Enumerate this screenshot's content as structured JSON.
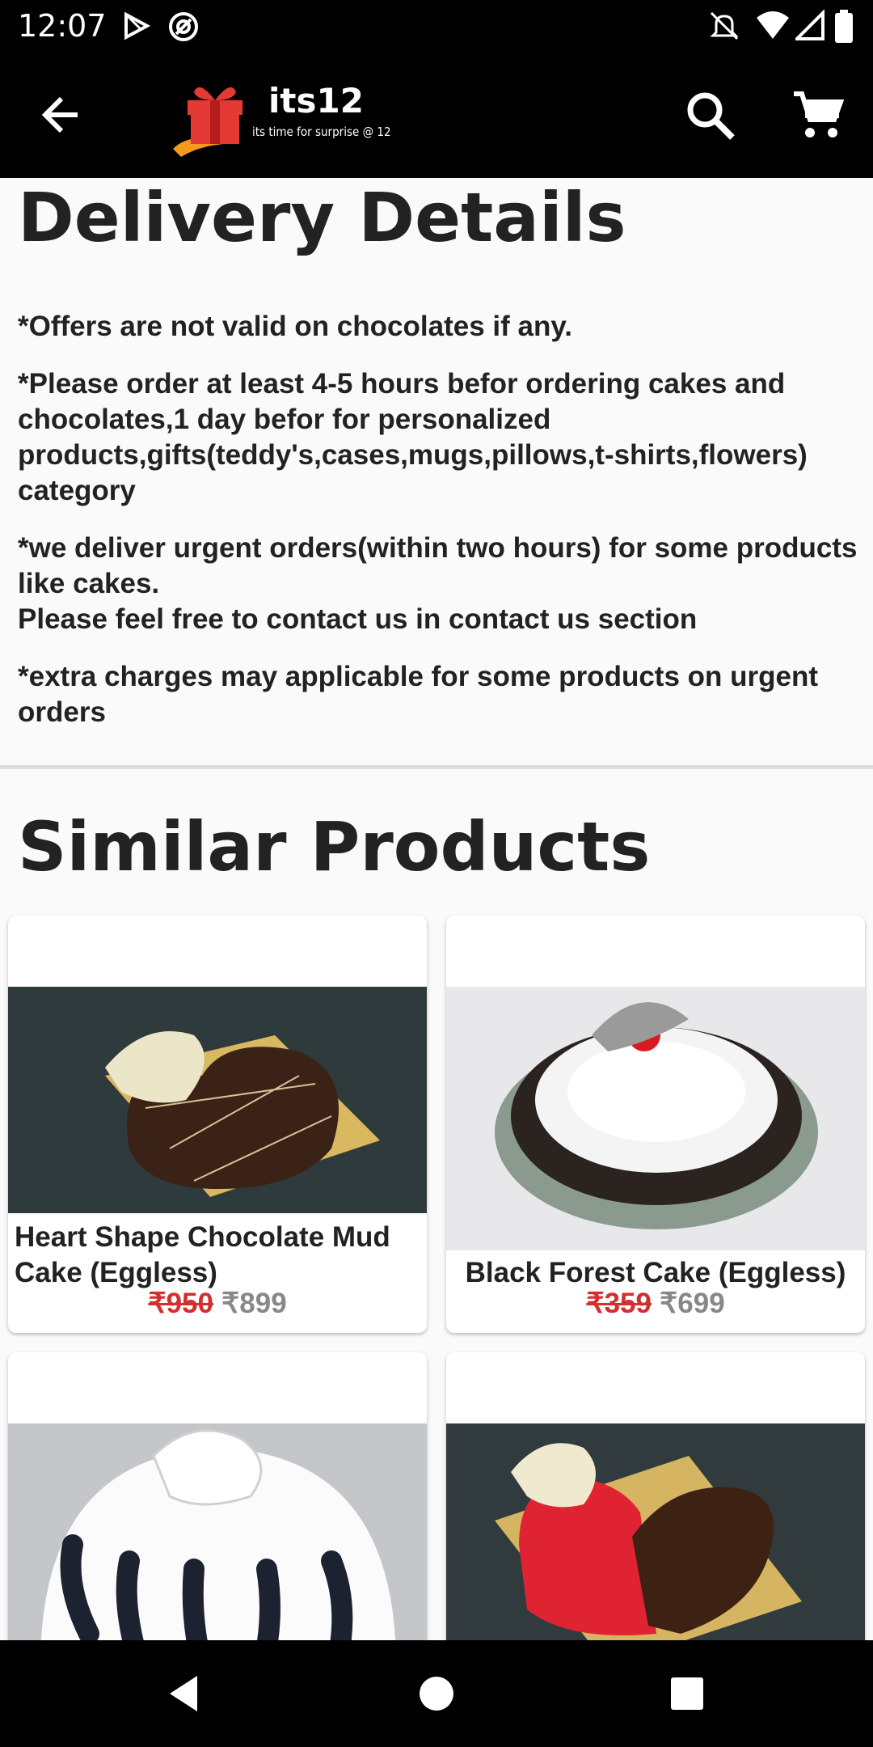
{
  "status_bar": {
    "time": "12:07",
    "icons": [
      "play-store-icon",
      "at-sign-icon",
      "bell-off-icon",
      "wifi-icon",
      "signal-icon",
      "battery-icon"
    ]
  },
  "toolbar": {
    "logo_title": "its12",
    "logo_tagline": "its time for surprise @ 12",
    "icons": [
      "back-arrow-icon",
      "search-icon",
      "cart-icon"
    ]
  },
  "delivery": {
    "title": "Delivery Details",
    "notes": [
      "*Offers are not valid on chocolates if any.",
      "*Please order at least 4-5 hours befor ordering cakes and chocolates,1 day befor for personalized products,gifts(teddy's,cases,mugs,pillows,t-shirts,flowers) category",
      "*we deliver urgent orders(within two hours) for some products like cakes.\n Please feel free to contact us in contact us section",
      "*extra charges may applicable for some products on urgent orders"
    ]
  },
  "similar": {
    "title": "Similar Products",
    "products": [
      {
        "name": "Heart Shape Chocolate Mud Cake (Eggless)",
        "old_price": "₹950",
        "price": "₹899"
      },
      {
        "name": "Black Forest Cake (Eggless)",
        "old_price": "₹359",
        "price": "₹699"
      },
      {
        "name": "",
        "old_price": "",
        "price": ""
      },
      {
        "name": "",
        "old_price": "",
        "price": ""
      }
    ]
  },
  "colors": {
    "bar_background": "#000000",
    "page_background": "#fafafa",
    "old_price": "#d32f2f",
    "price": "#888888"
  }
}
